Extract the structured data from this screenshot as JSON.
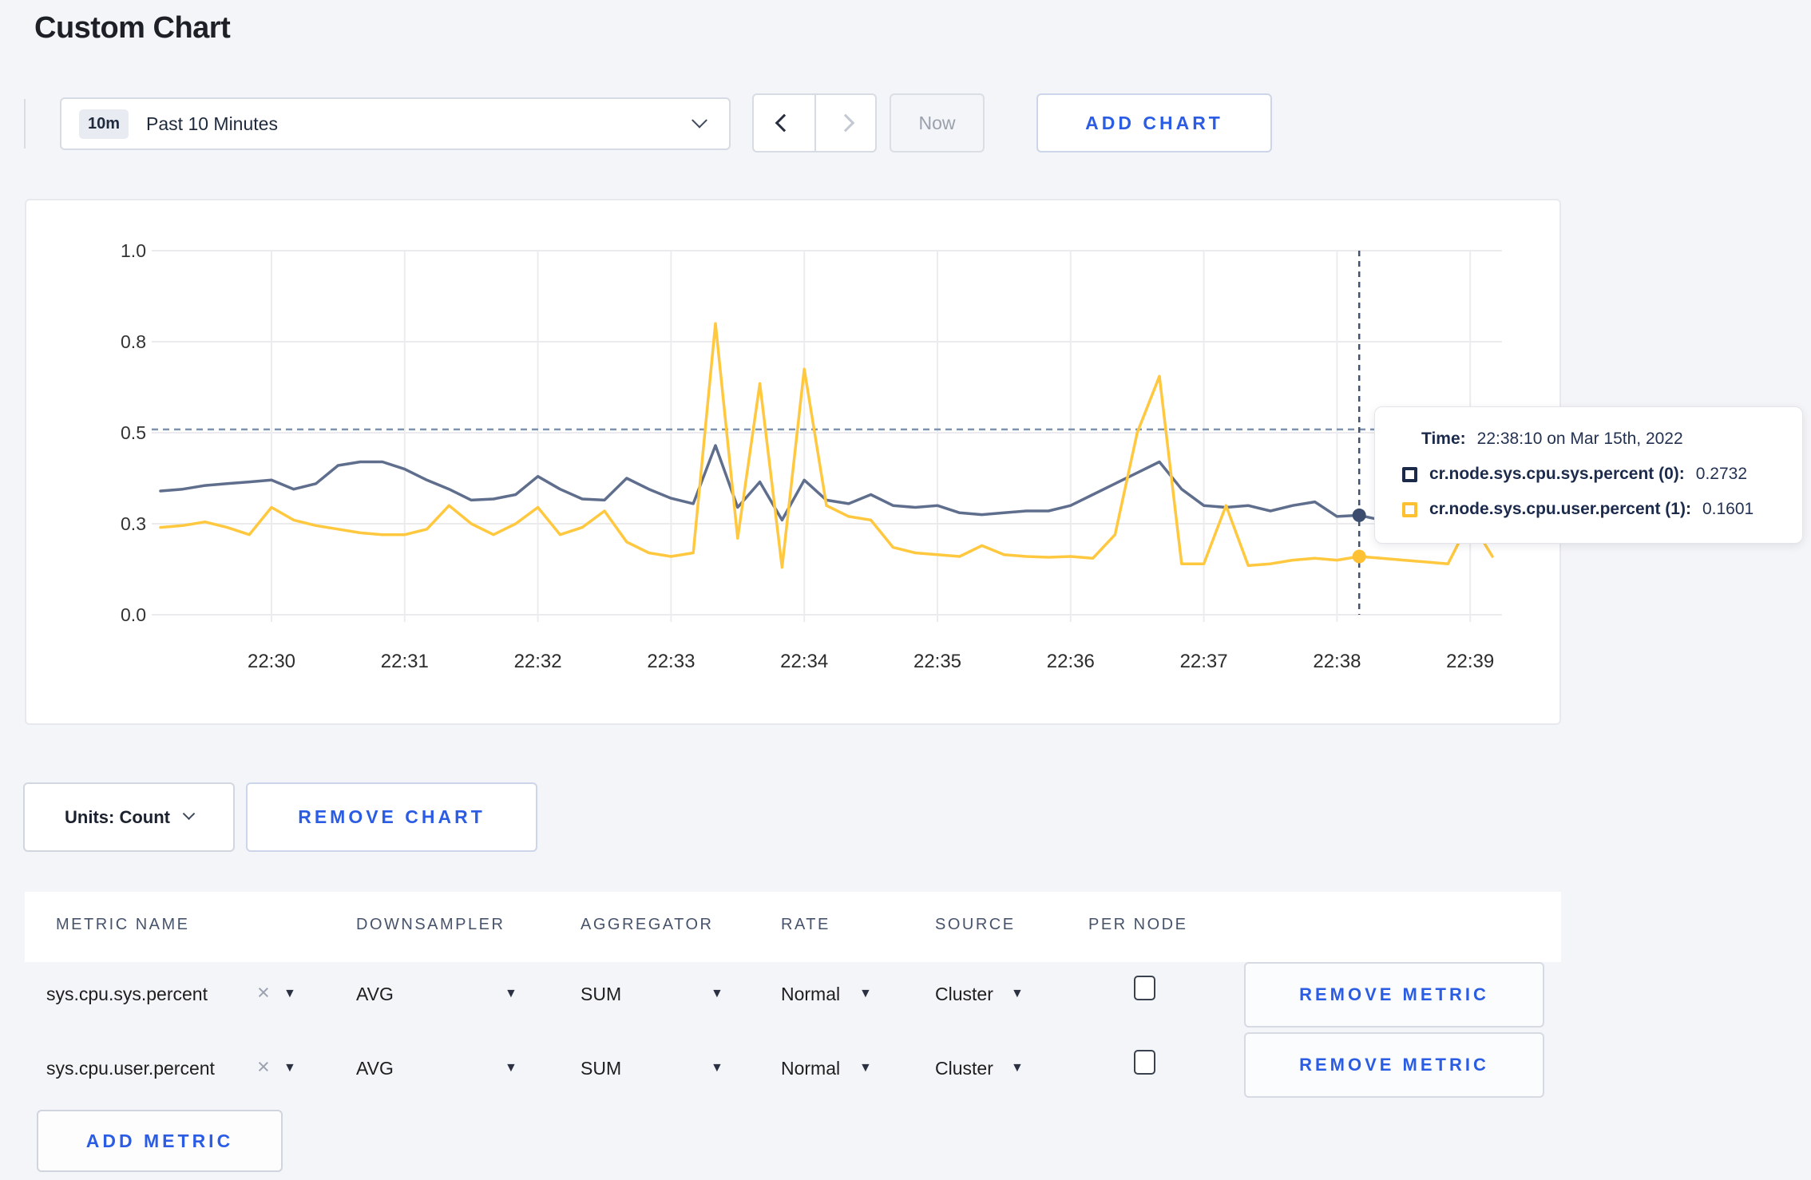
{
  "page": {
    "title": "Custom Chart"
  },
  "toolbar": {
    "time_window": {
      "badge": "10m",
      "label": "Past 10 Minutes"
    },
    "now_label": "Now",
    "add_chart_label": "ADD CHART"
  },
  "chart_controls": {
    "units_label": "Units: Count",
    "remove_chart_label": "REMOVE CHART"
  },
  "tooltip": {
    "time_label": "Time:",
    "time_value": "22:38:10 on Mar 15th, 2022",
    "rows": [
      {
        "label": "cr.node.sys.cpu.sys.percent (0):",
        "value": "0.2732",
        "swatch_color": "#1b2a49"
      },
      {
        "label": "cr.node.sys.cpu.user.percent (1):",
        "value": "0.1601",
        "swatch_color": "#fdc030"
      }
    ]
  },
  "metrics_table": {
    "headers": [
      "METRIC NAME",
      "DOWNSAMPLER",
      "AGGREGATOR",
      "RATE",
      "SOURCE",
      "PER NODE"
    ],
    "rows": [
      {
        "metric_name": "sys.cpu.sys.percent",
        "downsampler": "AVG",
        "aggregator": "SUM",
        "rate": "Normal",
        "source": "Cluster",
        "per_node_checked": false,
        "remove_label": "REMOVE METRIC"
      },
      {
        "metric_name": "sys.cpu.user.percent",
        "downsampler": "AVG",
        "aggregator": "SUM",
        "rate": "Normal",
        "source": "Cluster",
        "per_node_checked": false,
        "remove_label": "REMOVE METRIC"
      }
    ],
    "add_metric_label": "ADD METRIC"
  },
  "chart_data": {
    "type": "line",
    "title": "",
    "xlabel": "",
    "ylabel": "",
    "ylim": [
      0,
      1
    ],
    "grid": true,
    "legend_position": "tooltip",
    "x_ticks": [
      "22:30",
      "22:31",
      "22:32",
      "22:33",
      "22:34",
      "22:35",
      "22:36",
      "22:37",
      "22:38",
      "22:39"
    ],
    "y_ticks": [
      {
        "value": 1.0,
        "label": "1.0"
      },
      {
        "value": 0.75,
        "label": "0.8"
      },
      {
        "value": 0.5,
        "label": "0.5"
      },
      {
        "value": 0.25,
        "label": "0.3"
      },
      {
        "value": 0.0,
        "label": "0.0"
      }
    ],
    "start_time": "22:29:10",
    "step_seconds": 10,
    "series": [
      {
        "name": "cr.node.sys.cpu.sys.percent",
        "color": "#5f6e8d",
        "point_color": "#3c4d6f",
        "values": [
          0.34,
          0.345,
          0.355,
          0.36,
          0.365,
          0.37,
          0.345,
          0.36,
          0.41,
          0.42,
          0.42,
          0.4,
          0.37,
          0.345,
          0.315,
          0.318,
          0.33,
          0.38,
          0.345,
          0.318,
          0.315,
          0.375,
          0.345,
          0.32,
          0.305,
          0.465,
          0.295,
          0.365,
          0.26,
          0.37,
          0.315,
          0.305,
          0.33,
          0.3,
          0.295,
          0.3,
          0.28,
          0.275,
          0.28,
          0.285,
          0.285,
          0.3,
          0.33,
          0.36,
          0.39,
          0.42,
          0.345,
          0.3,
          0.295,
          0.3,
          0.285,
          0.3,
          0.31,
          0.27,
          0.2732,
          0.26,
          0.28,
          0.29,
          0.3,
          0.295,
          0.3
        ]
      },
      {
        "name": "cr.node.sys.cpu.user.percent",
        "color": "#ffc83e",
        "point_color": "#fdc133",
        "values": [
          0.24,
          0.245,
          0.255,
          0.24,
          0.22,
          0.295,
          0.26,
          0.245,
          0.235,
          0.225,
          0.22,
          0.22,
          0.235,
          0.3,
          0.25,
          0.22,
          0.25,
          0.295,
          0.22,
          0.24,
          0.285,
          0.2,
          0.17,
          0.16,
          0.17,
          0.8,
          0.21,
          0.635,
          0.13,
          0.675,
          0.3,
          0.27,
          0.26,
          0.185,
          0.17,
          0.165,
          0.16,
          0.19,
          0.165,
          0.16,
          0.158,
          0.16,
          0.155,
          0.22,
          0.5,
          0.655,
          0.14,
          0.14,
          0.3,
          0.135,
          0.14,
          0.15,
          0.155,
          0.15,
          0.1601,
          0.155,
          0.15,
          0.145,
          0.14,
          0.26,
          0.16
        ]
      }
    ],
    "crosshair": {
      "time": "22:38:10",
      "guideline_value": 0.509,
      "series_values": [
        0.2732,
        0.1601
      ]
    }
  }
}
